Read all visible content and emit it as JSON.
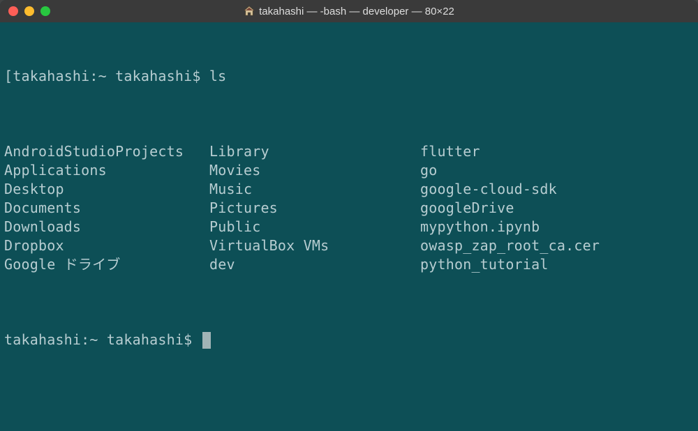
{
  "window": {
    "title": "takahashi — -bash — developer — 80×22"
  },
  "prompt1": {
    "host": "takahashi",
    "sep": ":",
    "path": "~",
    "user": "takahashi",
    "dollar": "$"
  },
  "command1": "ls",
  "ls": {
    "colA": [
      "AndroidStudioProjects",
      "Applications",
      "Desktop",
      "Documents",
      "Downloads",
      "Dropbox",
      "Google ドライブ"
    ],
    "colB": [
      "Library",
      "Movies",
      "Music",
      "Pictures",
      "Public",
      "VirtualBox VMs",
      "dev"
    ],
    "colC": [
      "flutter",
      "go",
      "google-cloud-sdk",
      "googleDrive",
      "mypython.ipynb",
      "owasp_zap_root_ca.cer",
      "python_tutorial"
    ]
  },
  "prompt2": {
    "host": "takahashi",
    "sep": ":",
    "path": "~",
    "user": "takahashi",
    "dollar": "$"
  }
}
